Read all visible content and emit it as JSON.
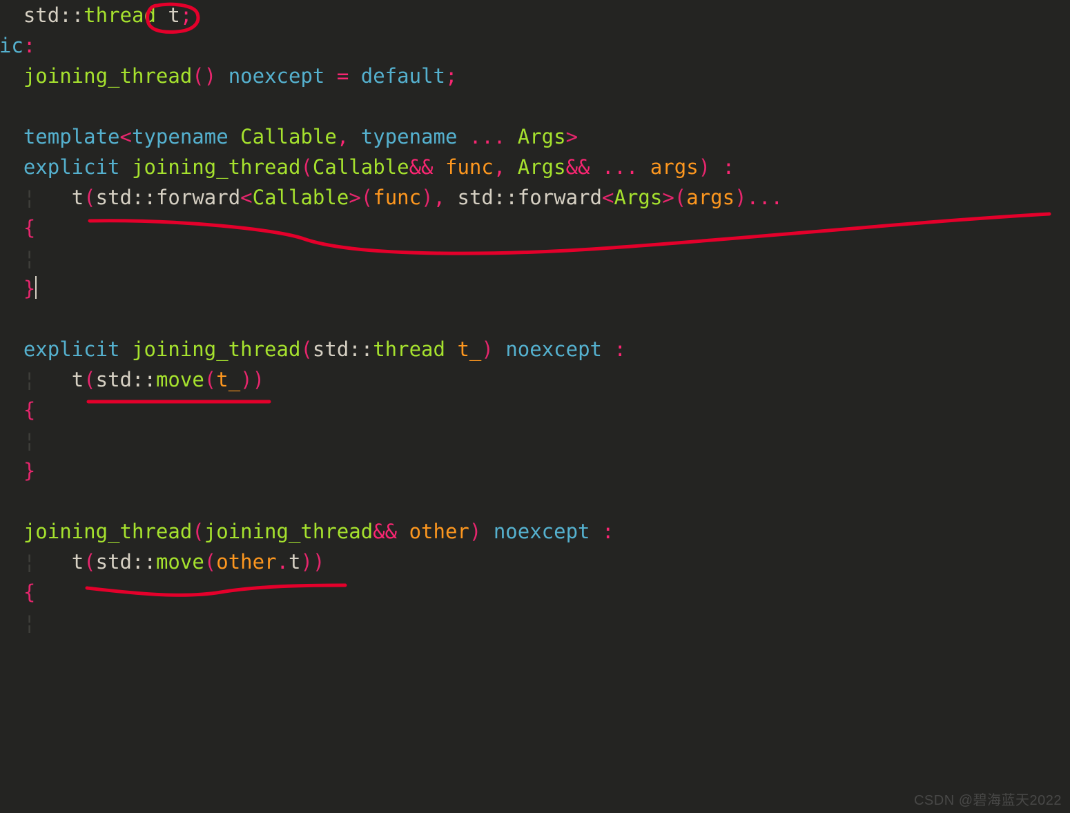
{
  "colors": {
    "background": "#242422",
    "keyword": "#55b1cf",
    "type": "#a6e22e",
    "pink": "#f92672",
    "orange": "#fd971f",
    "plain": "#d6d0c3",
    "annotation": "#e4002b"
  },
  "code": {
    "l1": {
      "ind": "    ",
      "std": "std",
      "dc": "::",
      "thread": "thread",
      "sp": " ",
      "t": "t",
      "semi": ";"
    },
    "l2": {
      "public": "blic",
      "colon": ":"
    },
    "l3": {
      "ind": "    ",
      "jt": "joining_thread",
      "po": "(",
      "pc": ")",
      "sp": " ",
      "noexcept": "noexcept",
      "eq": " = ",
      "default": "default",
      "semi": ";"
    },
    "l4": {
      "blank": ""
    },
    "l5": {
      "ind": "    ",
      "template": "template",
      "lt": "<",
      "typename1": "typename",
      "sp1": " ",
      "callable": "Callable",
      "comma": ", ",
      "typename2": "typename",
      "dots": " ... ",
      "args": "Args",
      "gt": ">"
    },
    "l6": {
      "ind": "    ",
      "explicit": "explicit",
      "sp1": " ",
      "jt": "joining_thread",
      "po": "(",
      "callable": "Callable",
      "amp1": "&&",
      "sp2": " ",
      "func": "func",
      "comma": ", ",
      "args": "Args",
      "amp2": "&&",
      "dots": " ... ",
      "argsv": "args",
      "pc": ")",
      "colon": " :"
    },
    "l7": {
      "ind": "        ",
      "t": "t",
      "po1": "(",
      "std1": "std",
      "dc1": "::",
      "forward1": "forward",
      "lt1": "<",
      "callable": "Callable",
      "gt1": ">",
      "po2": "(",
      "func": "func",
      "pc2": ")",
      "comma": ", ",
      "std2": "std",
      "dc2": "::",
      "forward2": "forward",
      "lt2": "<",
      "args": "Args",
      "gt2": ">",
      "po3": "(",
      "argsv": "args",
      "pc3": ")",
      "ell": "..."
    },
    "l8": {
      "ind": "    ",
      "brace": "{"
    },
    "l9": {
      "ind": "    ",
      "guide": ""
    },
    "l10": {
      "ind": "    ",
      "brace": "}"
    },
    "l11": {
      "blank": ""
    },
    "l12": {
      "ind": "    ",
      "explicit": "explicit",
      "sp1": " ",
      "jt": "joining_thread",
      "po": "(",
      "std": "std",
      "dc": "::",
      "thread": "thread",
      "sp2": " ",
      "t_": "t_",
      "pc": ")",
      "sp3": " ",
      "noexcept": "noexcept",
      "colon": " :"
    },
    "l13": {
      "ind": "        ",
      "t": "t",
      "po1": "(",
      "std": "std",
      "dc": "::",
      "move": "move",
      "po2": "(",
      "t_": "t_",
      "pc2": ")",
      "pc1": ")"
    },
    "l14": {
      "ind": "    ",
      "brace": "{"
    },
    "l15": {
      "ind": "    ",
      "guide": ""
    },
    "l16": {
      "ind": "    ",
      "brace": "}"
    },
    "l17": {
      "blank": ""
    },
    "l18": {
      "ind": "    ",
      "jt": "joining_thread",
      "po": "(",
      "jt2": "joining_thread",
      "amp": "&&",
      "sp": " ",
      "other": "other",
      "pc": ")",
      "sp2": " ",
      "noexcept": "noexcept",
      "colon": " :"
    },
    "l19": {
      "ind": "        ",
      "t": "t",
      "po1": "(",
      "std": "std",
      "dc": "::",
      "move": "move",
      "po2": "(",
      "other": "other",
      "dot": ".",
      "tmem": "t",
      "pc2": ")",
      "pc1": ")"
    },
    "l20": {
      "ind": "    ",
      "brace": "{"
    },
    "l21": {
      "ind": "    ",
      "guide": ""
    }
  },
  "watermark": "CSDN @碧海蓝天2022"
}
